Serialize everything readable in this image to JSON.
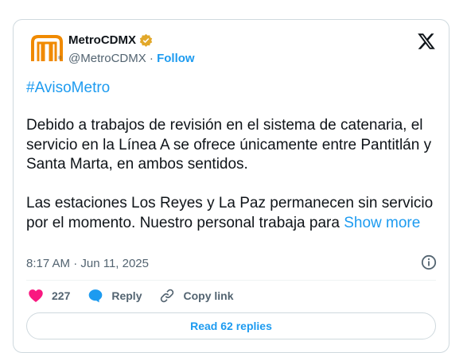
{
  "author": {
    "name": "MetroCDMX",
    "handle": "@MetroCDMX",
    "separator": " · ",
    "follow_label": "Follow",
    "verified_color": "#e2a82a",
    "logo_color": "#f08a00",
    "logo_icon": "metro-logo-icon"
  },
  "header": {
    "brand_icon": "x-logo-icon"
  },
  "tweet": {
    "hashtag": "#AvisoMetro",
    "paragraph1": "Debido a trabajos de revisión en el sistema de catenaria, el servicio en la Línea A se ofrece únicamente entre Pantitlán y Santa Marta, en ambos sentidos.",
    "paragraph2": "Las estaciones Los Reyes y La Paz permanecen sin servicio por el momento. Nuestro personal trabaja para ",
    "show_more_label": "Show more",
    "timestamp": "8:17 AM · Jun 11, 2025"
  },
  "actions": {
    "like_count": "227",
    "like_color": "#f91880",
    "reply_label": "Reply",
    "reply_color": "#1d9bf0",
    "copy_link_label": "Copy link"
  },
  "footer": {
    "read_replies_label": "Read 62 replies"
  }
}
